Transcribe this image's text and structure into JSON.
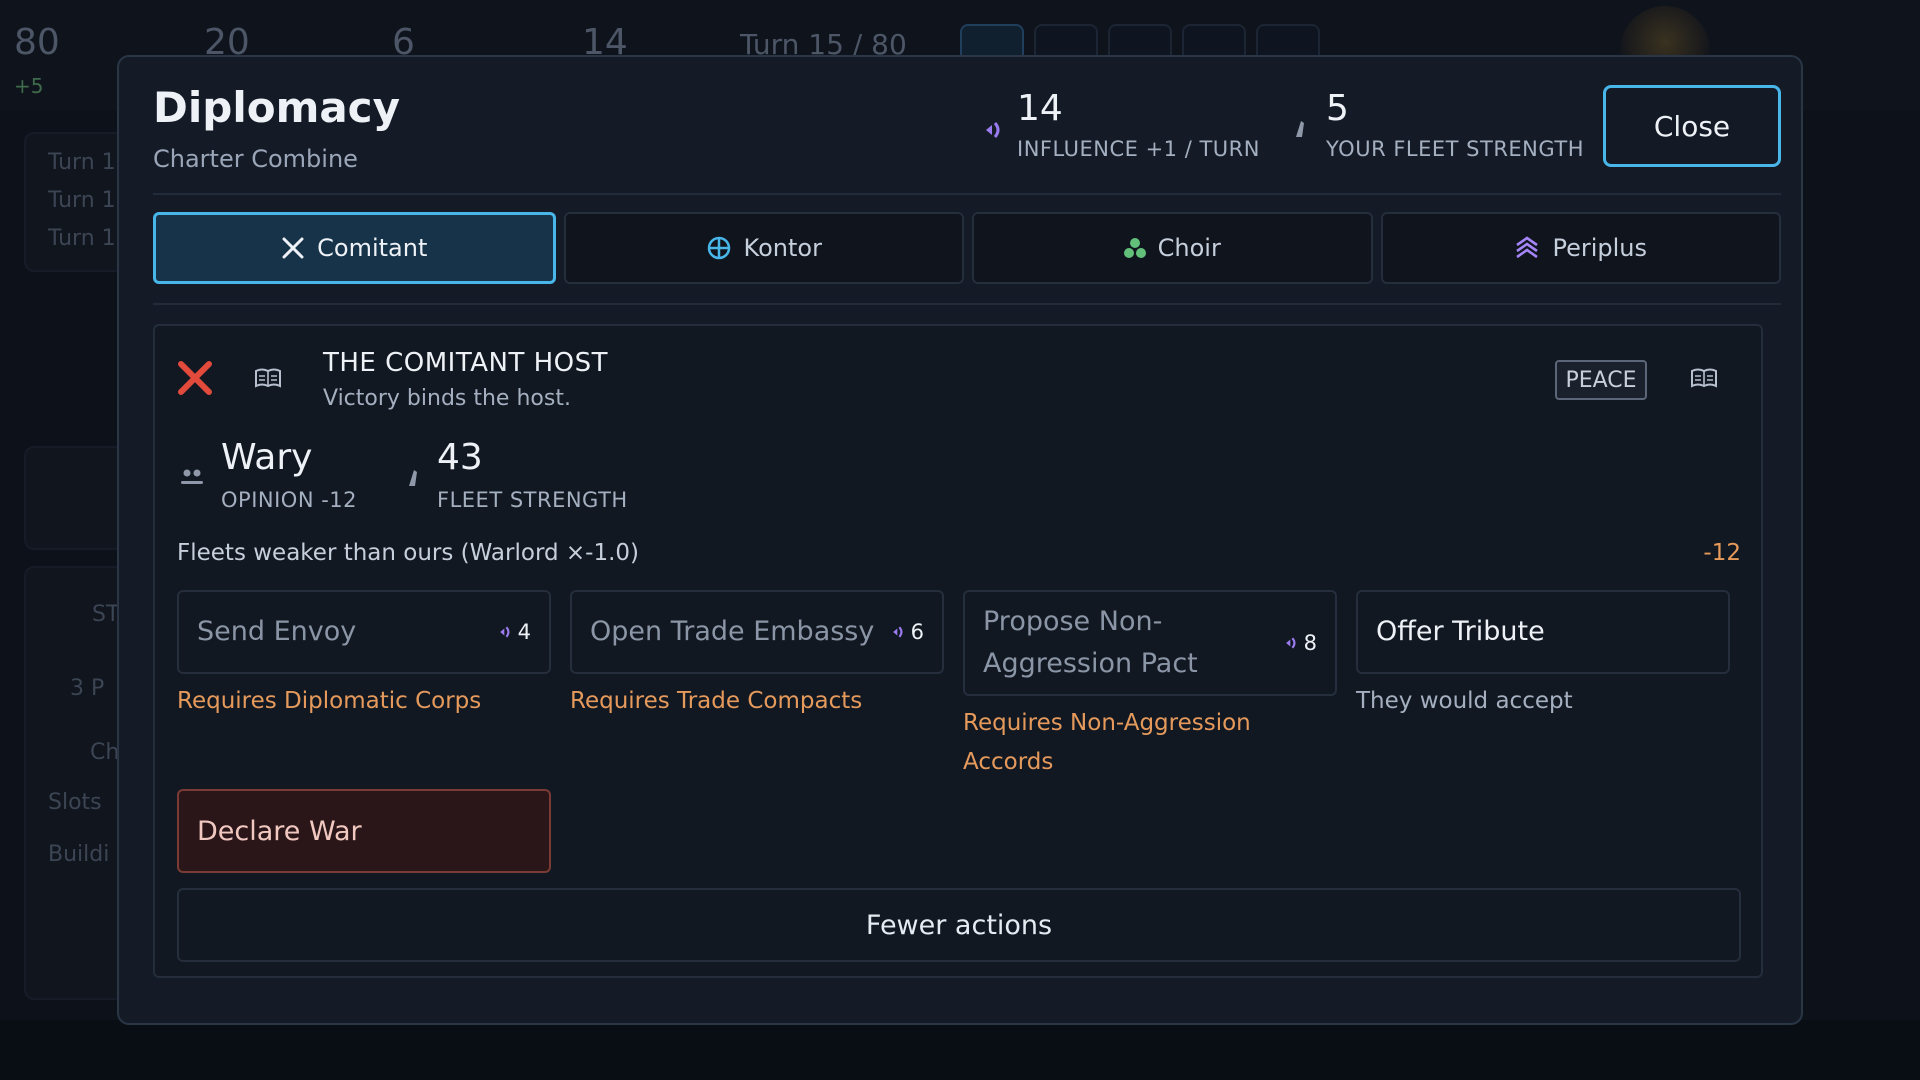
{
  "background": {
    "resources": [
      {
        "value": "80",
        "sub": "+5"
      },
      {
        "value": "20"
      },
      {
        "value": "6"
      },
      {
        "value": "14"
      }
    ],
    "turn_label": "Turn 15 / 80",
    "log_lines": [
      "Turn 1",
      "Turn 1",
      "Turn 1"
    ],
    "side_items": [
      "ST",
      "3 P",
      "Ch",
      "Slots",
      "Buildi"
    ]
  },
  "modal": {
    "title": "Diplomacy",
    "subtitle": "Charter Combine",
    "header_stats": [
      {
        "value": "14",
        "label": "INFLUENCE +1 / TURN",
        "icon": "influence-icon"
      },
      {
        "value": "5",
        "label": "YOUR FLEET STRENGTH",
        "icon": "fleet-icon"
      }
    ],
    "close_label": "Close",
    "tabs": [
      {
        "label": "Comitant",
        "icon": "crossed-swords-icon",
        "active": true
      },
      {
        "label": "Kontor",
        "icon": "trade-globe-icon",
        "active": false
      },
      {
        "label": "Choir",
        "icon": "choir-cluster-icon",
        "active": false
      },
      {
        "label": "Periplus",
        "icon": "chevrons-up-icon",
        "active": false
      }
    ],
    "faction": {
      "name": "THE COMITANT HOST",
      "motto": "Victory binds the host.",
      "status": "PEACE",
      "opinion": {
        "value": "Wary",
        "label": "OPINION -12"
      },
      "fleet": {
        "value": "43",
        "label": "FLEET STRENGTH"
      },
      "modifier": {
        "text": "Fleets weaker than ours (Warlord ×-1.0)",
        "value": "-12"
      },
      "actions": [
        {
          "label": "Send Envoy",
          "cost": "4",
          "note": "Requires Diplomatic Corps",
          "enabled": false
        },
        {
          "label": "Open Trade Embassy",
          "cost": "6",
          "note": "Requires Trade Compacts",
          "enabled": false
        },
        {
          "label": "Propose Non-Aggression Pact",
          "cost": "8",
          "note": "Requires Non-Aggression Accords",
          "enabled": false
        },
        {
          "label": "Offer Tribute",
          "cost": "",
          "note": "They would accept",
          "enabled": true
        }
      ],
      "declare_war_label": "Declare War",
      "fewer_actions_label": "Fewer actions"
    },
    "colors": {
      "accent": "#49b6ea",
      "influence": "#9a7cf0",
      "warning": "#e59a5c",
      "danger": "#e24a3c"
    }
  }
}
